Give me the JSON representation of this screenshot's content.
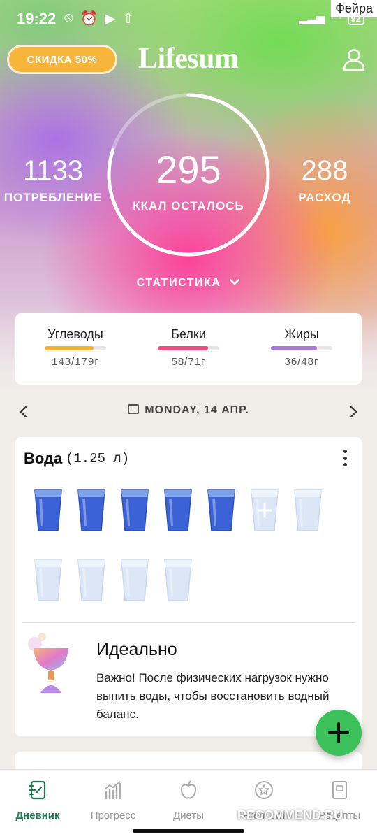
{
  "status_bar": {
    "time": "19:22",
    "battery": "92",
    "watermark": "Фейра"
  },
  "header": {
    "promo_label": "СКИДКА 50%",
    "logo": "Lifesum"
  },
  "summary": {
    "eaten_value": "1133",
    "eaten_label": "ПОТРЕБЛЕНИЕ",
    "remaining_value": "295",
    "remaining_label": "ККАЛ ОСТАЛОСЬ",
    "burned_value": "288",
    "burned_label": "РАСХОД",
    "stats_toggle": "СТАТИСТИКА",
    "ring_progress": 0.8
  },
  "macros": [
    {
      "name": "Углеводы",
      "value": "143/179г",
      "progress": 0.8,
      "color": "#f0b43a"
    },
    {
      "name": "Белки",
      "value": "58/71г",
      "progress": 0.82,
      "color": "#e8507e"
    },
    {
      "name": "Жиры",
      "value": "36/48г",
      "progress": 0.75,
      "color": "#a77ad9"
    }
  ],
  "date": {
    "label": "MONDAY, 14 АПР."
  },
  "water": {
    "title": "Вода",
    "amount": "(1.25 л)",
    "glasses_filled": 5,
    "glasses_total": 11,
    "tip_title": "Идеально",
    "tip_text": "Важно! После физических нагрузок нужно выпить воды, чтобы восстановить водный баланс."
  },
  "nav": [
    {
      "label": "Дневник",
      "icon": "diary-icon",
      "active": true
    },
    {
      "label": "Прогресс",
      "icon": "progress-chart-icon",
      "active": false
    },
    {
      "label": "Диеты",
      "icon": "apple-icon",
      "active": false
    },
    {
      "label": "Premium",
      "icon": "star-icon",
      "active": false
    },
    {
      "label": "Рецепты",
      "icon": "recipe-book-icon",
      "active": false
    }
  ],
  "colors": {
    "accent_green": "#3cc15a",
    "active_nav": "#1a7a4c",
    "promo": "#f7b53c"
  },
  "watermark_bottom": "RECOMMEND.RU"
}
